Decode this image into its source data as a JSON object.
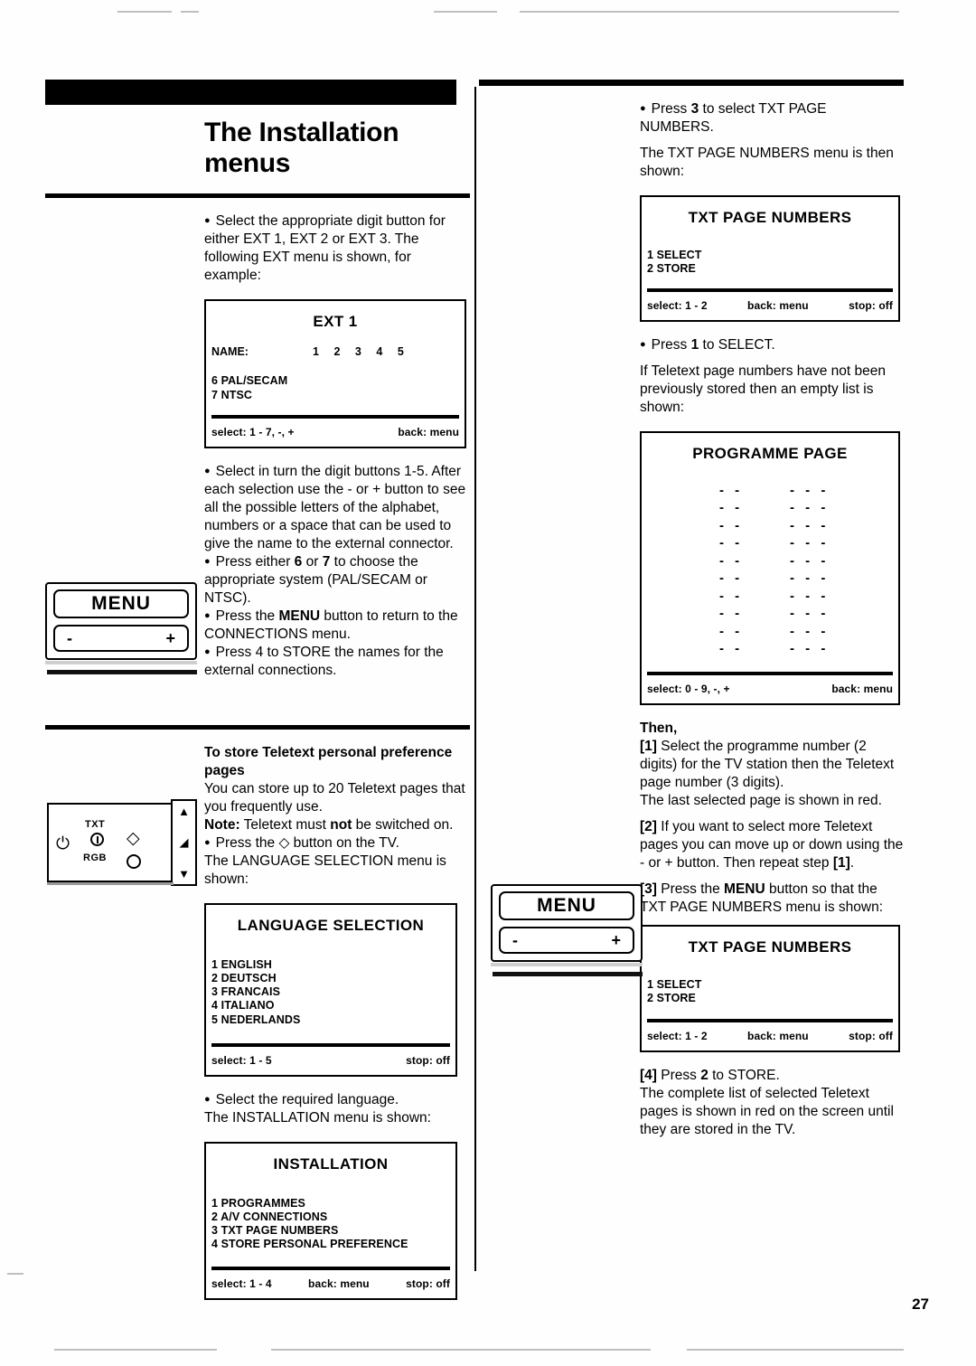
{
  "page": {
    "folio": "27",
    "title": "The Installation menus"
  },
  "left_column": {
    "intro": {
      "bullet1_line1": "Select the appropriate digit button",
      "bullet1_rest": "for either EXT 1, EXT 2 or EXT 3. The following EXT menu is shown, for example:"
    },
    "ext_menu": {
      "title": "EXT 1",
      "name_label": "NAME:",
      "digits": [
        "1",
        "2",
        "3",
        "4",
        "5"
      ],
      "options": [
        "6 PAL/SECAM",
        "7 NTSC"
      ],
      "footer_select": "select: 1 - 7, -, +",
      "footer_back": "back: menu"
    },
    "steps": {
      "b1_head": "Select in turn the digit buttons 1-5.",
      "b1_rest": "After each selection use the - or + button to see all the possible letters of the alphabet, numbers or a space  that can be used to give the name to the external connector.",
      "b2_pre": "Press either ",
      "b2_k1": "6",
      "b2_mid": " or ",
      "b2_k2": "7",
      "b2_post": " to choose the appropriate system (PAL/SECAM or NTSC).",
      "b3_pre": "Press the ",
      "b3_k": "MENU",
      "b3_post": " button to return to the CONNECTIONS menu.",
      "b4": "Press 4 to STORE the names for the external connections."
    },
    "teletext_section": {
      "heading": "To store Teletext personal preference pages",
      "para1": "You can store up to 20 Teletext pages that you frequently use.",
      "note_label": "Note:",
      "note_pre": " Teletext must ",
      "note_bold": "not",
      "note_post": " be switched on.",
      "bullet_pre": "Press the ",
      "bullet_glyph": "◇",
      "bullet_post": " button on the TV.",
      "after_bullet": "The LANGUAGE SELECTION menu is shown:"
    },
    "language_menu": {
      "title": "LANGUAGE SELECTION",
      "items": [
        "1 ENGLISH",
        "2 DEUTSCH",
        "3 FRANCAIS",
        "4 ITALIANO",
        "5 NEDERLANDS"
      ],
      "footer_select": "select: 1 - 5",
      "footer_stop": "stop: off"
    },
    "after_language": {
      "bullet": "Select the required language.",
      "line": "The INSTALLATION menu is shown:"
    },
    "installation_menu": {
      "title": "INSTALLATION",
      "items": [
        "1 PROGRAMMES",
        "2 A/V CONNECTIONS",
        "3 TXT PAGE NUMBERS",
        "4 STORE PERSONAL PREFERENCE"
      ],
      "footer_select": "select: 1 - 4",
      "footer_back": "back: menu",
      "footer_stop": "stop: off"
    },
    "remote_illustration": {
      "menu_label": "MENU",
      "minus_label": "-",
      "plus_label": "+"
    },
    "tv_illustration": {
      "txt_label": "TXT",
      "rgb_label": "RGB",
      "power_glyph": "⏻",
      "diamond_glyph": "◇",
      "up_glyph": "▲",
      "volume_glyph": "◢",
      "down_glyph": "▼"
    }
  },
  "right_column": {
    "top": {
      "bullet_pre": "Press ",
      "bullet_key": "3",
      "bullet_post": " to select TXT PAGE NUMBERS.",
      "para": "The TXT PAGE NUMBERS menu is then shown:"
    },
    "txt_page_numbers_menu": {
      "title": "TXT PAGE NUMBERS",
      "items": [
        "1 SELECT",
        "2 STORE"
      ],
      "footer_select": "select: 1 - 2",
      "footer_back": "back: menu",
      "footer_stop": "stop: off"
    },
    "select_step": {
      "bullet_pre": "Press ",
      "bullet_key": "1",
      "bullet_post": " to SELECT.",
      "para": "If Teletext page numbers have not been previously stored then an empty list is shown:"
    },
    "programme_page_menu": {
      "title": "PROGRAMME PAGE",
      "row_count": 10,
      "programme_placeholder": "- -",
      "page_placeholder": "- - -",
      "footer_select": "select: 0 - 9, -, +",
      "footer_back": "back: menu"
    },
    "then_steps": {
      "heading": "Then,",
      "s1_label": "[1]",
      "s1_text": " Select the programme number (2 digits) for the TV station then the Teletext page number (3 digits).",
      "s1_extra": "The last selected page is shown in red.",
      "s2_label": "[2]",
      "s2_text": " If you want to select more Teletext pages you can move up or down using the - or + button. Then repeat step ",
      "s2_ref": "[1]",
      "s2_end": ".",
      "s3_label": "[3]",
      "s3_pre": " Press the ",
      "s3_key": "MENU",
      "s3_post": " button so that the TXT PAGE NUMBERS menu is shown:"
    },
    "txt_page_numbers_menu_2": {
      "title": "TXT PAGE NUMBERS",
      "items": [
        "1 SELECT",
        "2 STORE"
      ],
      "footer_select": "select: 1 - 2",
      "footer_back": "back: menu",
      "footer_stop": "stop: off"
    },
    "store_step": {
      "s4_label": "[4]",
      "s4_pre": " Press ",
      "s4_key": "2",
      "s4_post": " to STORE.",
      "para": "The complete list of selected Teletext pages is shown in red on the screen until they are stored in the TV."
    },
    "remote_illustration": {
      "menu_label": "MENU",
      "minus_label": "-",
      "plus_label": "+"
    }
  }
}
